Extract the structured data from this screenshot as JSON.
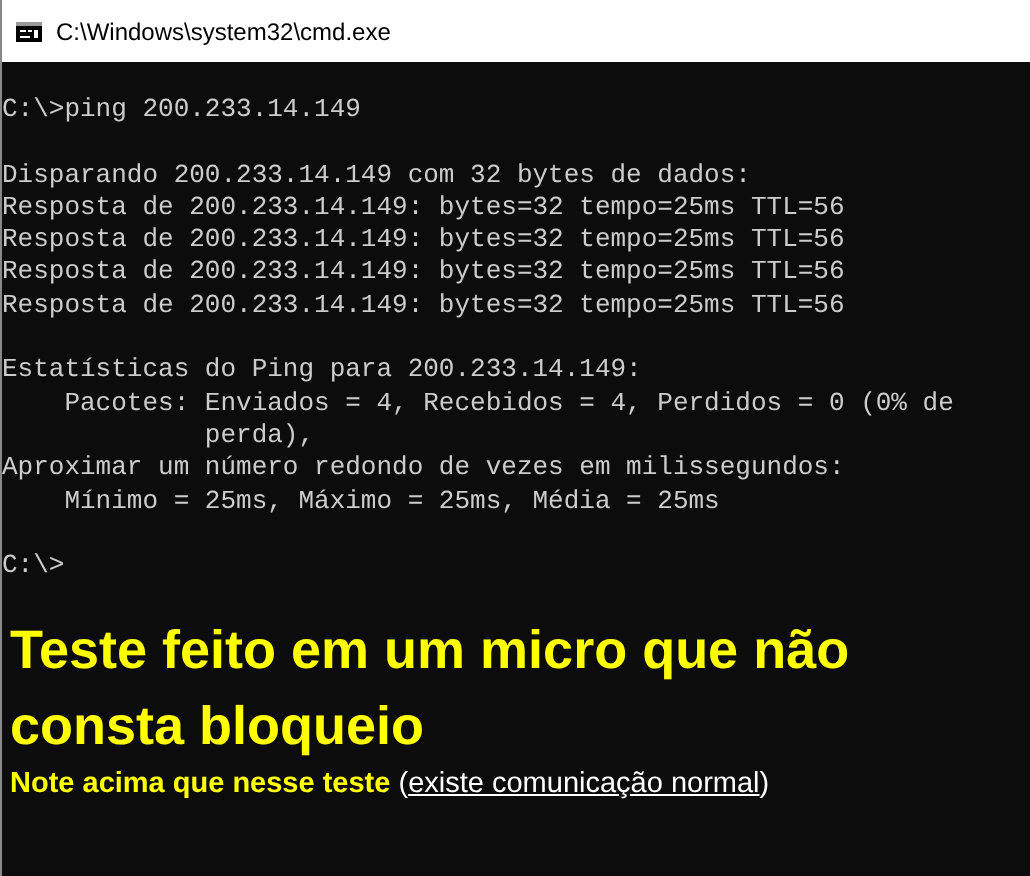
{
  "window": {
    "title": "C:\\Windows\\system32\\cmd.exe"
  },
  "console": {
    "blocks": [
      [
        "C:\\>ping 200.233.14.149"
      ],
      [
        "Disparando 200.233.14.149 com 32 bytes de dados:",
        "Resposta de 200.233.14.149: bytes=32 tempo=25ms TTL=56",
        "Resposta de 200.233.14.149: bytes=32 tempo=25ms TTL=56",
        "Resposta de 200.233.14.149: bytes=32 tempo=25ms TTL=56",
        "Resposta de 200.233.14.149: bytes=32 tempo=25ms TTL=56"
      ],
      [
        "Estatísticas do Ping para 200.233.14.149:",
        "    Pacotes: Enviados = 4, Recebidos = 4, Perdidos = 0 (0% de",
        "             perda),",
        "Aproximar um número redondo de vezes em milissegundos:",
        "    Mínimo = 25ms, Máximo = 25ms, Média = 25ms"
      ],
      [
        "C:\\>"
      ]
    ]
  },
  "caption": {
    "heading": "Teste feito em um micro que não consta bloqueio",
    "note": {
      "text": "Note acima que nesse teste",
      "open": "(",
      "underlined": "existe comunicação normal",
      "close": ")"
    }
  }
}
